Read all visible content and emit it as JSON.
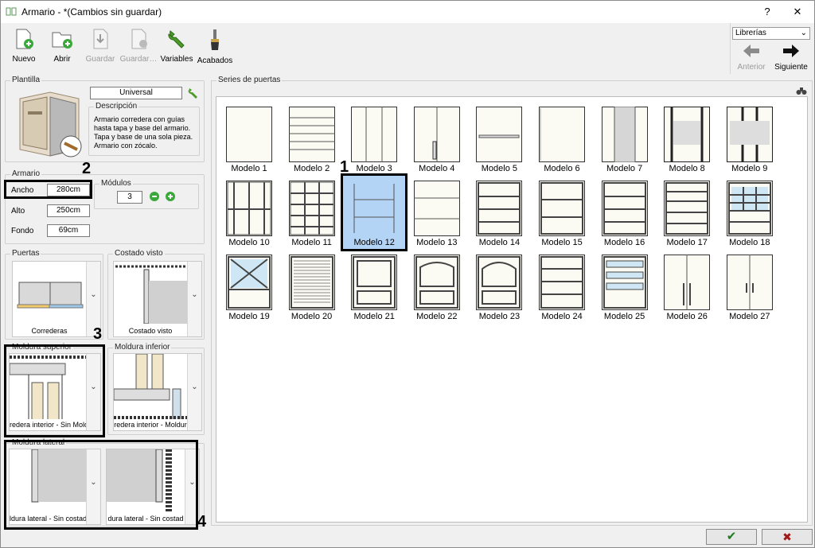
{
  "window": {
    "app": "Armario -",
    "status": "*(Cambios sin guardar)",
    "help": "?",
    "close": "✕"
  },
  "toolbar": {
    "nuevo": "Nuevo",
    "abrir": "Abrir",
    "guardar": "Guardar",
    "guardar_como": "Guardar…",
    "variables": "Variables",
    "acabados": "Acabados",
    "library_select": "Librerías",
    "anterior": "Anterior",
    "siguiente": "Siguiente"
  },
  "plantilla": {
    "legend": "Plantilla",
    "name": "Universal",
    "desc_legend": "Descripción",
    "description": "Armario corredera con guías hasta tapa y base del armario. Tapa y base de una sola pieza. Armario con zócalo."
  },
  "armario": {
    "legend": "Armario",
    "ancho_label": "Ancho",
    "ancho": "280cm",
    "alto_label": "Alto",
    "alto": "250cm",
    "fondo_label": "Fondo",
    "fondo": "69cm",
    "modulos_legend": "Módulos",
    "modulos": "3"
  },
  "puertas": {
    "legend": "Puertas",
    "value": "Correderas"
  },
  "costado": {
    "legend": "Costado visto",
    "value": "Costado visto"
  },
  "moldura_sup": {
    "legend": "Moldura superior",
    "value": "redera interior - Sin Mold"
  },
  "moldura_inf": {
    "legend": "Moldura inferior",
    "value": "redera interior - Moldur"
  },
  "moldura_lat": {
    "legend": "Moldura lateral",
    "value_left": "ldura lateral - Sin costad",
    "value_right": "dura lateral - Sin costad"
  },
  "series": {
    "legend": "Series de puertas",
    "selected": "Modelo 12",
    "models": [
      "Modelo 1",
      "Modelo 2",
      "Modelo 3",
      "Modelo 4",
      "Modelo 5",
      "Modelo 6",
      "Modelo 7",
      "Modelo 8",
      "Modelo 9",
      "Modelo 10",
      "Modelo 11",
      "Modelo 12",
      "Modelo 13",
      "Modelo 14",
      "Modelo 15",
      "Modelo 16",
      "Modelo 17",
      "Modelo 18",
      "Modelo 19",
      "Modelo 20",
      "Modelo 21",
      "Modelo 22",
      "Modelo 23",
      "Modelo 24",
      "Modelo 25",
      "Modelo 26",
      "Modelo 27"
    ]
  },
  "annotations": {
    "n1": "1",
    "n2": "2",
    "n3": "3",
    "n4": "4"
  },
  "footer": {
    "ok": "✔",
    "cancel": "✖"
  },
  "colors": {
    "selection": "#b3d4f5",
    "glass": "#cfe7f4",
    "ok": "#1f7a1f",
    "cancel": "#a01818"
  }
}
